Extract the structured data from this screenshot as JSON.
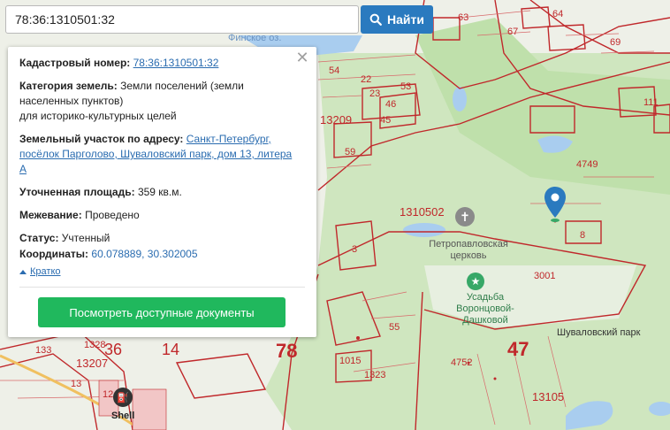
{
  "search": {
    "value": "78:36:1310501:32",
    "button_label": "Найти"
  },
  "panel": {
    "cadastral_label": "Кадастровый номер:",
    "cadastral_value": "78:36:1310501:32",
    "category_label": "Категория земель:",
    "category_line1": "Земли поселений (земли",
    "category_line2": "населенных пунктов)",
    "category_line3": "для историко-культурных целей",
    "address_label": "Земельный участок по адресу:",
    "address_line1": "Санкт-Петербург,",
    "address_line2": "посёлок Парголово, Шуваловский парк, дом 13, литера",
    "address_line3": "А",
    "area_label": "Уточненная площадь:",
    "area_value": "359 кв.м.",
    "survey_label": "Межевание:",
    "survey_value": "Проведено",
    "status_label": "Статус:",
    "status_value": "Учтенный",
    "coords_label": "Координаты:",
    "coords_value": "60.078889, 30.302005",
    "collapse_label": "Кратко",
    "docs_button": "Посмотреть доступные документы",
    "close_icon": "close-icon"
  },
  "map": {
    "lake_label": "Финское оз.",
    "big_labels": [
      "78",
      "47"
    ],
    "quarter_labels": [
      "13209",
      "1310502",
      "13207",
      "13105",
      "1328"
    ],
    "parcel_labels": [
      "63",
      "64",
      "67",
      "69",
      "54",
      "22",
      "23",
      "53",
      "46",
      "45",
      "59",
      "4749",
      "8",
      "3001",
      "3",
      "55",
      "1015",
      "1323",
      "4752",
      "1244",
      "133",
      "36",
      "14",
      "13",
      "111"
    ],
    "poi_church": "Петропавловская церковь",
    "poi_estate": "Усадьба Воронцовой-Дашковой",
    "poi_park": "Шуваловский парк",
    "poi_shell": "Shell",
    "colors": {
      "boundary": "#c0282b",
      "park": "#c8e3b7",
      "water": "#a9cdef",
      "button": "#2a7abf",
      "docs": "#20b85d",
      "marker": "#2a7abf"
    }
  }
}
